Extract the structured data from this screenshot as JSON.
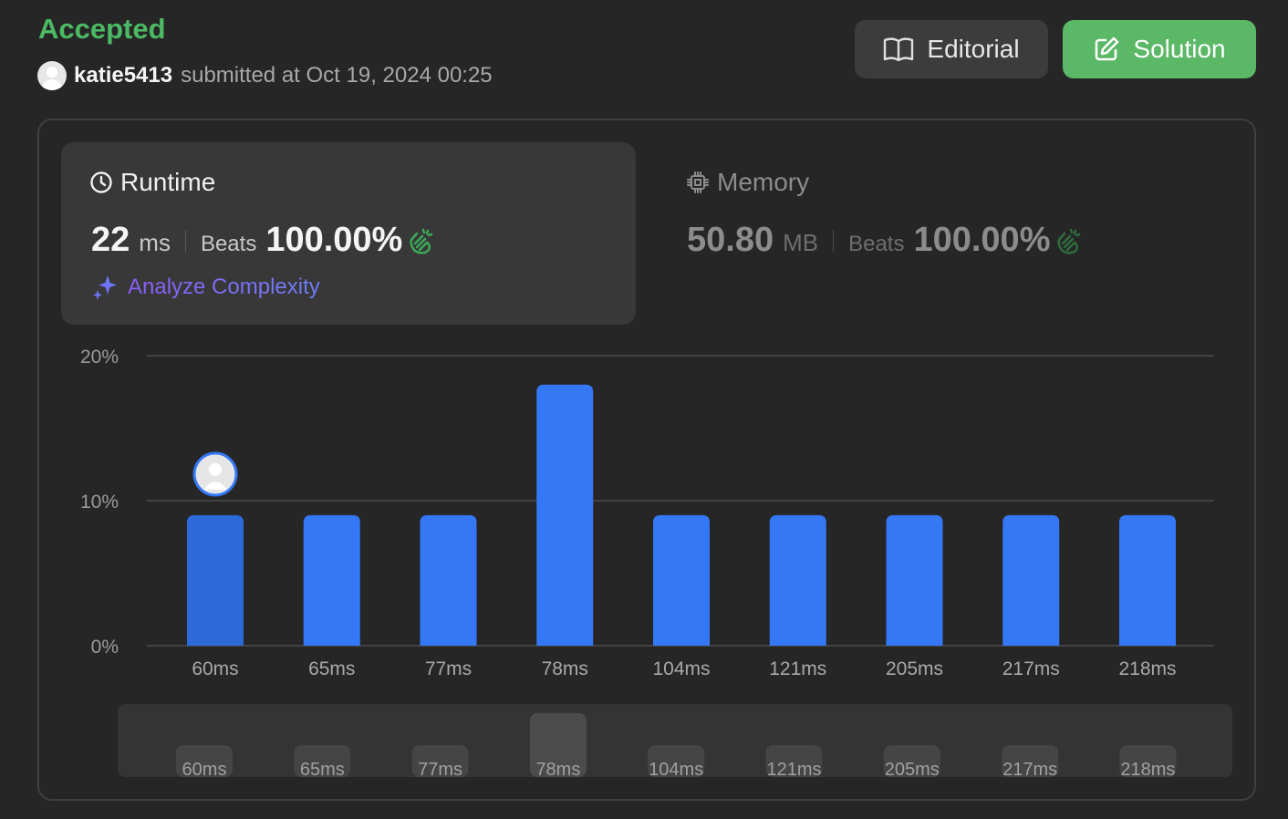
{
  "header": {
    "status": "Accepted",
    "username": "katie5413",
    "submitted_text": "submitted at Oct 19, 2024 00:25",
    "editorial_label": "Editorial",
    "solution_label": "Solution"
  },
  "runtime": {
    "title": "Runtime",
    "value": "22",
    "unit": "ms",
    "beats_label": "Beats",
    "beats_value": "100.00%",
    "analyze_label": "Analyze Complexity"
  },
  "memory": {
    "title": "Memory",
    "value": "50.80",
    "unit": "MB",
    "beats_label": "Beats",
    "beats_value": "100.00%"
  },
  "colors": {
    "accepted": "#4cb964",
    "bar": "#3478f6",
    "bar_user": "#2c69d9",
    "solution_button": "#5bb866"
  },
  "chart_data": {
    "type": "bar",
    "categories": [
      "60ms",
      "65ms",
      "77ms",
      "78ms",
      "104ms",
      "121ms",
      "205ms",
      "217ms",
      "218ms"
    ],
    "values": [
      9,
      9,
      9,
      18,
      9,
      9,
      9,
      9,
      9
    ],
    "yticks": [
      "20%",
      "10%",
      "0%"
    ],
    "ylim": [
      0,
      20
    ],
    "grid": true,
    "user_category": "60ms",
    "highlighted_category": "78ms",
    "range_selector": {
      "categories": [
        "60ms",
        "65ms",
        "77ms",
        "78ms",
        "104ms",
        "121ms",
        "205ms",
        "217ms",
        "218ms"
      ],
      "values": [
        9,
        9,
        9,
        18,
        9,
        9,
        9,
        9,
        9
      ]
    }
  }
}
